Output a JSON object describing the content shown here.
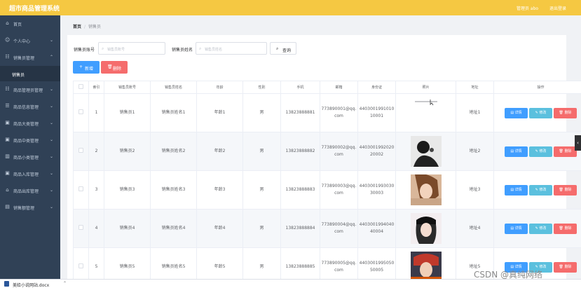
{
  "header": {
    "title": "超市商品管理系统",
    "user": "管理员 abo",
    "logout": "退出登录"
  },
  "sidebar": {
    "items": [
      {
        "label": "首页",
        "icon": "home-icon",
        "glyph": "⌂",
        "chev": ""
      },
      {
        "label": "个人中心",
        "icon": "user-icon",
        "glyph": "☺",
        "chev": "⌄"
      },
      {
        "label": "销售员管理",
        "icon": "group-icon",
        "glyph": "☷",
        "chev": "⌃"
      },
      {
        "label": "商品管理员管理",
        "icon": "group-icon",
        "glyph": "☷",
        "chev": "⌄"
      },
      {
        "label": "商品信息管理",
        "icon": "list-icon",
        "glyph": "☰",
        "chev": "⌄"
      },
      {
        "label": "商品大类管理",
        "icon": "box-icon",
        "glyph": "▣",
        "chev": "⌄"
      },
      {
        "label": "商品中类管理",
        "icon": "box-icon",
        "glyph": "▣",
        "chev": "⌄"
      },
      {
        "label": "商品小类管理",
        "icon": "chart-icon",
        "glyph": "▥",
        "chev": "⌄"
      },
      {
        "label": "商品入库管理",
        "icon": "box-icon",
        "glyph": "▣",
        "chev": "⌄"
      },
      {
        "label": "商品出库管理",
        "icon": "shop-icon",
        "glyph": "⌂",
        "chev": "⌄"
      },
      {
        "label": "销售额管理",
        "icon": "doc-icon",
        "glyph": "▤",
        "chev": "⌄"
      }
    ],
    "sub_item": "销售员"
  },
  "breadcrumb": {
    "home": "首页",
    "sep": "/",
    "current": "销售员"
  },
  "search": {
    "account_label": "销售员账号",
    "account_placeholder": "销售员账号",
    "name_label": "销售员姓名",
    "name_placeholder": "销售员姓名",
    "button": "查询",
    "search_icon": "⌕"
  },
  "actions": {
    "add": "新增",
    "delete": "删除",
    "add_icon": "+",
    "delete_icon": "🗑"
  },
  "table": {
    "columns": [
      "",
      "索引",
      "销售员账号",
      "销售员姓名",
      "年龄",
      "性别",
      "手机",
      "邮箱",
      "身份证",
      "照片",
      "地址",
      "操作"
    ],
    "rows": [
      {
        "idx": "1",
        "account": "销售员1",
        "name": "销售员姓名1",
        "age": "年龄1",
        "gender": "男",
        "phone": "13823888881",
        "email": "773890001@qq.com",
        "id_card": "440300199101010001",
        "address": "地址1",
        "photo": ""
      },
      {
        "idx": "2",
        "account": "销售员2",
        "name": "销售员姓名2",
        "age": "年龄2",
        "gender": "男",
        "phone": "13823888882",
        "email": "773890002@qq.com",
        "id_card": "440300199202020002",
        "address": "地址2",
        "photo": "silhouette"
      },
      {
        "idx": "3",
        "account": "销售员3",
        "name": "销售员姓名3",
        "age": "年龄3",
        "gender": "男",
        "phone": "13823888883",
        "email": "773890003@qq.com",
        "id_card": "440300199303030003",
        "address": "地址3",
        "photo": "portrait"
      },
      {
        "idx": "4",
        "account": "销售员4",
        "name": "销售员姓名4",
        "age": "年龄4",
        "gender": "男",
        "phone": "13823888884",
        "email": "773890004@qq.com",
        "id_card": "440300199404040004",
        "address": "地址4",
        "photo": "portrait-hat"
      },
      {
        "idx": "5",
        "account": "销售员5",
        "name": "销售员姓名5",
        "age": "年龄5",
        "gender": "男",
        "phone": "13823888885",
        "email": "773890005@qq.com",
        "id_card": "440300199505050005",
        "address": "地址5",
        "photo": "portrait-red"
      }
    ],
    "ops": {
      "view": "详情",
      "edit": "修改",
      "delete": "删除",
      "view_icon": "▤",
      "edit_icon": "✎",
      "delete_icon": "🗑"
    }
  },
  "download_bar": {
    "filename": "美给小说网站.docx",
    "chev": "⌃"
  },
  "watermark": "CSDN @真纯网络",
  "colors": {
    "header": "#f5c842",
    "sidebar": "#304156",
    "primary": "#409eff",
    "danger": "#f56c6c",
    "info": "#5bc0de"
  }
}
